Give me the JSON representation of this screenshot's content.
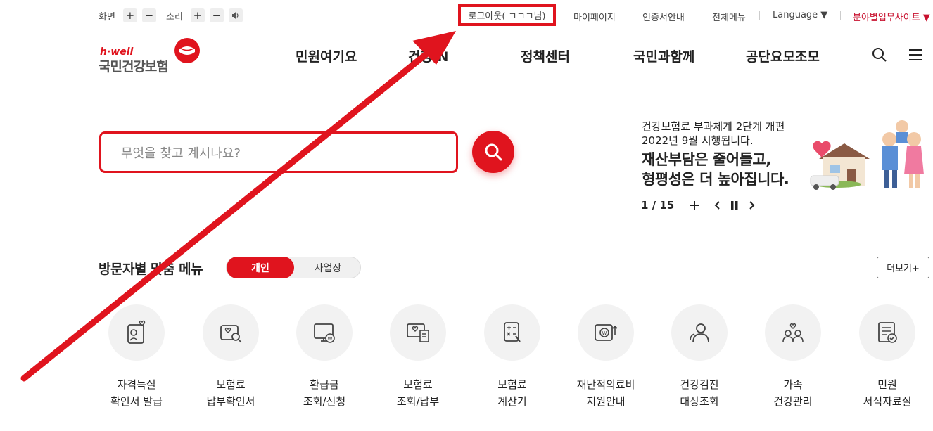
{
  "util": {
    "screen_label": "화면",
    "sound_label": "소리",
    "plus": "+",
    "minus": "−",
    "login": "로그아웃( ㄱㄱㄱ님)",
    "mypage": "마이페이지",
    "cert": "인증서안내",
    "allmenu": "전체메뉴",
    "language": "Language ▼",
    "sites": "분야별업무사이트 ▼"
  },
  "logo": {
    "hwell": "h·well",
    "name": "국민건강보험"
  },
  "gnb": [
    "민원여기요",
    "건강iN",
    "정책센터",
    "국민과함께",
    "공단요모조모"
  ],
  "search": {
    "placeholder": "무엇을 찾고 계시나요?"
  },
  "banner": {
    "sub1": "건강보험료 부과체계 2단계 개편",
    "sub2": "2022년 9월 시행됩니다.",
    "head1": "재산부담은 줄어들고,",
    "head2": "형평성은 더 높아집니다.",
    "pager": "1 / 15"
  },
  "visitor": {
    "title": "방문자별 맞춤 메뉴",
    "personal": "개인",
    "business": "사업장",
    "more": "더보기+"
  },
  "menu": [
    {
      "l1": "자격득실",
      "l2": "확인서 발급",
      "icon": "certificate-icon"
    },
    {
      "l1": "보험료",
      "l2": "납부확인서",
      "icon": "payment-search-icon"
    },
    {
      "l1": "환급금",
      "l2": "조회/신청",
      "icon": "refund-monitor-icon"
    },
    {
      "l1": "보험료",
      "l2": "조회/납부",
      "icon": "premium-inquiry-icon"
    },
    {
      "l1": "보험료",
      "l2": "계산기",
      "icon": "calculator-icon"
    },
    {
      "l1": "재난적의료비",
      "l2": "지원안내",
      "icon": "medical-support-icon"
    },
    {
      "l1": "건강검진",
      "l2": "대상조회",
      "icon": "checkup-people-icon"
    },
    {
      "l1": "가족",
      "l2": "건강관리",
      "icon": "family-icon"
    },
    {
      "l1": "민원",
      "l2": "서식자료실",
      "icon": "forms-icon"
    }
  ],
  "colors": {
    "accent": "#e0141e",
    "annotation": "#e0141e"
  }
}
